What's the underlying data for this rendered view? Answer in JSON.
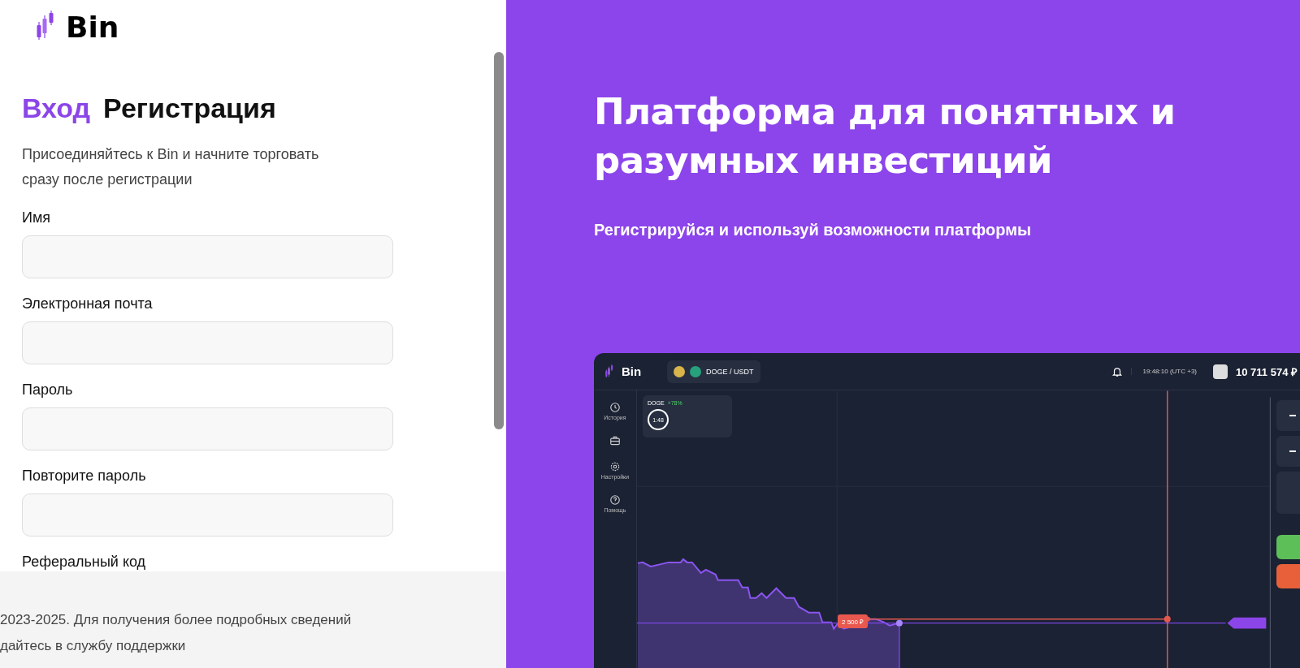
{
  "logo": {
    "text": "Bin"
  },
  "tabs": [
    {
      "label": "Вход",
      "selected": false
    },
    {
      "label": "Регистрация",
      "selected": true
    }
  ],
  "intro": "Присоединяйтесь к Bin и начните торговать сразу после регистрации",
  "fields": [
    {
      "label": "Имя"
    },
    {
      "label": "Электронная почта"
    },
    {
      "label": "Пароль"
    },
    {
      "label": "Повторите пароль"
    },
    {
      "label": "Реферальный код"
    }
  ],
  "footer": [
    "2023-2025. Для получения более подробных сведений",
    "дайтесь в службу поддержки"
  ],
  "promo": {
    "title": "Платформа для понятных и разумных инвестиций",
    "subtitle": "Регистрируйся и используй возможности платформы"
  },
  "app_preview": {
    "logo": "Bin",
    "pair": "DOGE / USDT",
    "time": "19:48:10 (UTC +3)",
    "balance": "10 711 574 ₽",
    "nav": [
      {
        "label": "История",
        "kind": "clock"
      },
      {
        "kind": "case"
      },
      {
        "label": "Настройки",
        "kind": "gear"
      },
      {
        "label": "Помощь",
        "kind": "help"
      }
    ],
    "deal": {
      "asset": "DOGE",
      "change": "+78%",
      "timer": "1:48"
    },
    "bet_tag": "2 500 ₽"
  }
}
